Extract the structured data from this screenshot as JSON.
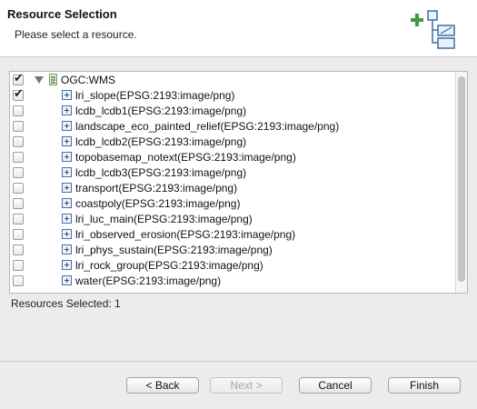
{
  "header": {
    "title": "Resource Selection",
    "subtitle": "Please select a resource.",
    "icon": "wizard-add-resource-icon"
  },
  "tree": {
    "root": {
      "label": "OGC:WMS",
      "checked": true,
      "expanded": true
    },
    "items": [
      {
        "label": "lri_slope(EPSG:2193:image/png)",
        "checked": true
      },
      {
        "label": "lcdb_lcdb1(EPSG:2193:image/png)",
        "checked": false
      },
      {
        "label": "landscape_eco_painted_relief(EPSG:2193:image/png)",
        "checked": false
      },
      {
        "label": "lcdb_lcdb2(EPSG:2193:image/png)",
        "checked": false
      },
      {
        "label": "topobasemap_notext(EPSG:2193:image/png)",
        "checked": false
      },
      {
        "label": "lcdb_lcdb3(EPSG:2193:image/png)",
        "checked": false
      },
      {
        "label": "transport(EPSG:2193:image/png)",
        "checked": false
      },
      {
        "label": "coastpoly(EPSG:2193:image/png)",
        "checked": false
      },
      {
        "label": "lri_luc_main(EPSG:2193:image/png)",
        "checked": false
      },
      {
        "label": "lri_observed_erosion(EPSG:2193:image/png)",
        "checked": false
      },
      {
        "label": "lri_phys_sustain(EPSG:2193:image/png)",
        "checked": false
      },
      {
        "label": "lri_rock_group(EPSG:2193:image/png)",
        "checked": false
      },
      {
        "label": "water(EPSG:2193:image/png)",
        "checked": false
      }
    ]
  },
  "status": {
    "text": "Resources Selected: 1"
  },
  "buttons": {
    "back": "< Back",
    "next": "Next >",
    "cancel": "Cancel",
    "finish": "Finish"
  }
}
